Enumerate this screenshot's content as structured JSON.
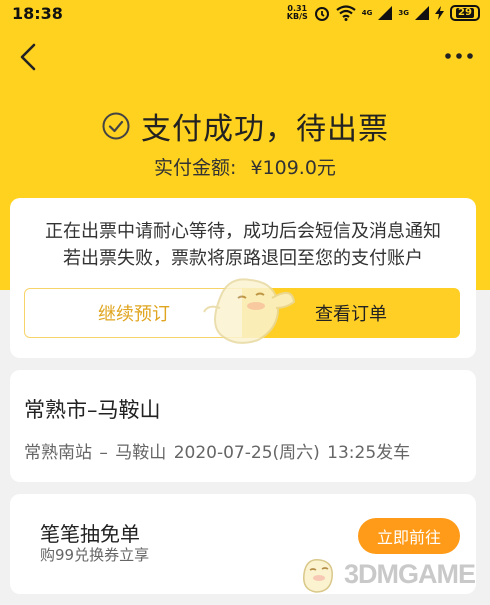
{
  "status_bar": {
    "time": "18:38",
    "net_speed_value": "0.31",
    "net_speed_unit": "KB/S",
    "sig1": "4G",
    "sig2": "3G",
    "battery": "29"
  },
  "title": "支付成功，待出票",
  "amount": {
    "label": "实付金额:",
    "value": "¥109.0元"
  },
  "notice": {
    "line1": "正在出票中请耐心等待，成功后会短信及消息通知",
    "line2": "若出票失败，票款将原路退回至您的支付账户"
  },
  "buttons": {
    "continue_label": "继续预订",
    "view_order_label": "查看订单"
  },
  "route": {
    "title": "常熟市–马鞍山",
    "detail": "常熟南站 – 马鞍山  2020-07-25(周六) 13:25发车"
  },
  "promo": {
    "title": "笔笔抽免单",
    "subtitle": "购99兑换券立享",
    "button_label": "立即前往"
  },
  "watermark": "3DMGAME",
  "colors": {
    "brand_yellow": "#ffd21f",
    "button_yellow": "#ffcf26",
    "promo_orange": "#ff9b18"
  }
}
